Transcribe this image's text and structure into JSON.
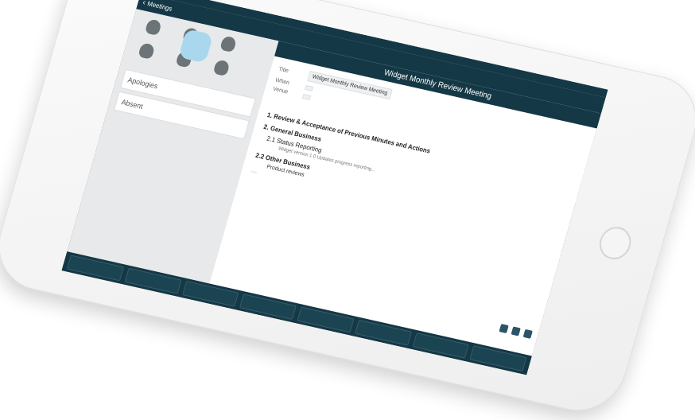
{
  "device": {
    "status": {
      "left": "",
      "right": ""
    }
  },
  "nav": {
    "back_label": "Meetings"
  },
  "left": {
    "people": [
      {
        "name": ""
      },
      {
        "name": ""
      },
      {
        "name": ""
      },
      {
        "name": ""
      },
      {
        "name": ""
      },
      {
        "name": ""
      }
    ],
    "attendance": {
      "apologies_label": "Apologies",
      "absent_label": "Absent"
    }
  },
  "main": {
    "title": "Widget Monthly Review Meeting",
    "fields": [
      {
        "label": "Title",
        "value": "Widget Monthly Review Meeting"
      },
      {
        "label": "When",
        "value": ""
      },
      {
        "label": "Venue",
        "value": ""
      }
    ],
    "agenda": [
      {
        "title": "1. Review & Acceptance of Previous Minutes and Actions",
        "items": []
      },
      {
        "title": "2. General Business",
        "items": [
          {
            "label": "2.1 Status Reporting",
            "subs": [
              "Widget version 1.0 Updates progress reporting..."
            ]
          }
        ]
      },
      {
        "title": "2.2 Other Business",
        "items": [
          {
            "label": "Product reviews",
            "subs": []
          }
        ]
      }
    ],
    "pill_label": ""
  },
  "toolbar": {
    "buttons": [
      "",
      "",
      "",
      "",
      "",
      "",
      "",
      ""
    ]
  },
  "colors": {
    "dark_teal": "#143846",
    "highlight": "#a9d8ee"
  },
  "icons": [
    "camera-icon",
    "home-button-icon",
    "chevron-left-icon",
    "person-icon"
  ]
}
